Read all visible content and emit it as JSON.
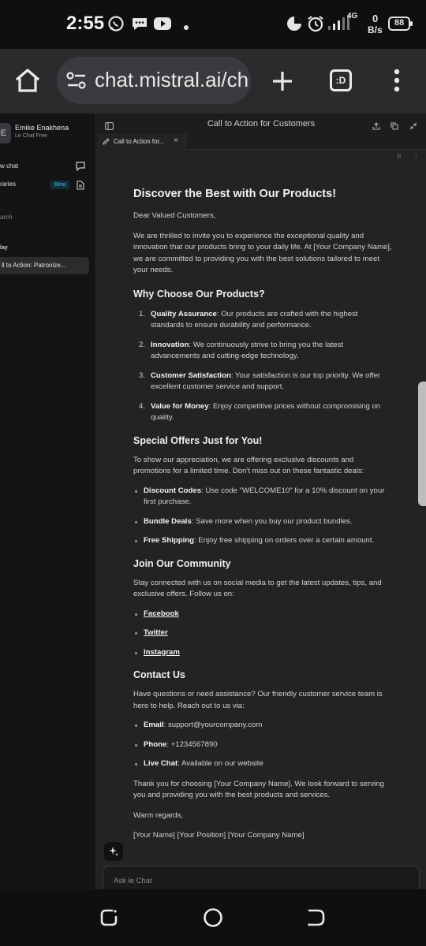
{
  "status": {
    "time": "2:55",
    "net": "4G",
    "speed_top": "0",
    "speed_bottom": "B/s",
    "battery": "88"
  },
  "browser": {
    "url": "chat.mistral.ai/ch",
    "tab_count": ":D"
  },
  "sidebar": {
    "avatar_letter": "E",
    "user_name": "Emike Enakhena",
    "plan": "Le Chat Free",
    "new_chat": "w chat",
    "libraries": "raries",
    "beta": "Beta",
    "search": "arch",
    "section_today": "lay",
    "active_chat": "ll to Action: Patronize..."
  },
  "main": {
    "title": "Call to Action for Customers",
    "tab_label": "Call to Action for...",
    "doc": {
      "h1": "Discover the Best with Our Products!",
      "greeting": "Dear Valued Customers,",
      "intro": "We are thrilled to invite you to experience the exceptional quality and innovation that our products bring to your daily life. At [Your Company Name], we are committed to providing you with the best solutions tailored to meet your needs.",
      "why_heading": "Why Choose Our Products?",
      "why_items": [
        {
          "num": "1.",
          "title": "Quality Assurance",
          "text": ": Our products are crafted with the highest standards to ensure durability and performance."
        },
        {
          "num": "2.",
          "title": "Innovation",
          "text": ": We continuously strive to bring you the latest advancements and cutting-edge technology."
        },
        {
          "num": "3.",
          "title": "Customer Satisfaction",
          "text": ": Your satisfaction is our top priority. We offer excellent customer service and support."
        },
        {
          "num": "4.",
          "title": "Value for Money",
          "text": ": Enjoy competitive prices without compromising on quality."
        }
      ],
      "offers_heading": "Special Offers Just for You!",
      "offers_intro": "To show our appreciation, we are offering exclusive discounts and promotions for a limited time. Don't miss out on these fantastic deals:",
      "offers_items": [
        {
          "title": "Discount Codes",
          "text": ": Use code \"WELCOME10\" for a 10% discount on your first purchase."
        },
        {
          "title": "Bundle Deals",
          "text": ": Save more when you buy our product bundles."
        },
        {
          "title": "Free Shipping",
          "text": ": Enjoy free shipping on orders over a certain amount."
        }
      ],
      "community_heading": "Join Our Community",
      "community_intro": "Stay connected with us on social media to get the latest updates, tips, and exclusive offers. Follow us on:",
      "social": [
        "Facebook",
        "Twitter",
        "Instagram"
      ],
      "contact_heading": "Contact Us",
      "contact_intro": "Have questions or need assistance? Our friendly customer service team is here to help. Reach out to us via:",
      "contact_items": [
        {
          "title": "Email",
          "text": ": support@yourcompany.com"
        },
        {
          "title": "Phone",
          "text": ": +1234567890"
        },
        {
          "title": "Live Chat",
          "text": ": Available on our website"
        }
      ],
      "thanks": "Thank you for choosing [Your Company Name]. We look forward to serving you and providing you with the best products and services.",
      "regards": "Warm regards,",
      "signature": "[Your Name] [Your Position] [Your Company Name]"
    },
    "ask_placeholder": "Ask le Chat"
  }
}
